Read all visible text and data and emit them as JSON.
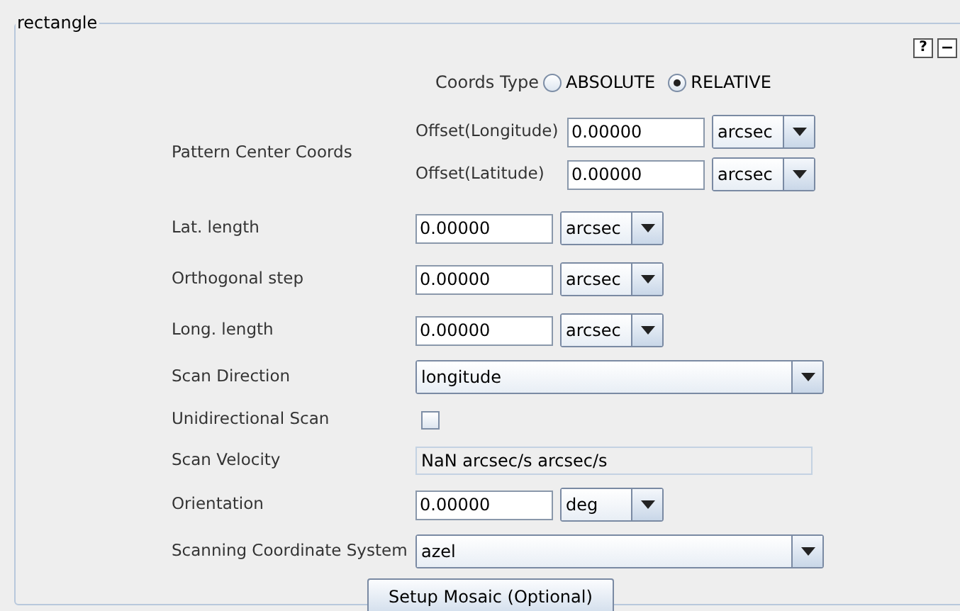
{
  "panel": {
    "title": "rectangle",
    "help_button": "?",
    "collapse_button": "−"
  },
  "coords_type": {
    "label": "Coords Type",
    "options": [
      {
        "label": "ABSOLUTE",
        "selected": false
      },
      {
        "label": "RELATIVE",
        "selected": true
      }
    ]
  },
  "pattern_center": {
    "label": "Pattern Center Coords",
    "fields": [
      {
        "label": "Offset(Longitude)",
        "value": "0.00000",
        "unit": "arcsec"
      },
      {
        "label": "Offset(Latitude)",
        "value": "0.00000",
        "unit": "arcsec"
      }
    ]
  },
  "rows": [
    {
      "kind": "unit",
      "label": "Lat. length",
      "value": "0.00000",
      "unit": "arcsec"
    },
    {
      "kind": "unit",
      "label": "Orthogonal step",
      "value": "0.00000",
      "unit": "arcsec"
    },
    {
      "kind": "unit",
      "label": "Long. length",
      "value": "0.00000",
      "unit": "arcsec"
    },
    {
      "kind": "combo",
      "label": "Scan Direction",
      "value": "longitude"
    },
    {
      "kind": "checkbox",
      "label": "Unidirectional Scan",
      "checked": false
    },
    {
      "kind": "readonly",
      "label": "Scan Velocity",
      "value": "NaN arcsec/s arcsec/s"
    },
    {
      "kind": "unit",
      "label": "Orientation",
      "value": "0.00000",
      "unit": "deg"
    },
    {
      "kind": "combo",
      "label": "Scanning Coordinate System",
      "value": "azel"
    }
  ],
  "button": "Setup Mosaic (Optional)"
}
